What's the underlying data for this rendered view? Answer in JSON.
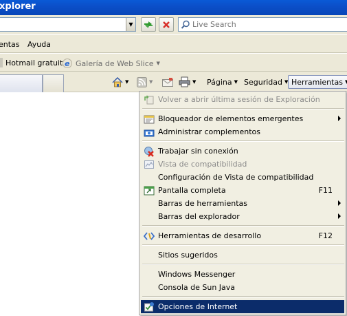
{
  "window": {
    "title": "xplorer"
  },
  "address": {
    "dropdown_glyph": "▼"
  },
  "search": {
    "placeholder": "Live Search"
  },
  "menubar": {
    "items": [
      "entas",
      "Ayuda"
    ]
  },
  "favorites": {
    "items": [
      {
        "label": "Hotmail gratuito",
        "icon": "page-icon"
      },
      {
        "label": "Galería de Web Slice",
        "icon": "ie-icon"
      }
    ]
  },
  "commandbar": {
    "page_label": "Página",
    "security_label": "Seguridad",
    "tools_label": "Herramientas"
  },
  "tools_menu": {
    "items": [
      {
        "label": "Volver a abrir última sesión de Exploración",
        "disabled": true,
        "icon": "reopen-session-icon"
      },
      {
        "label": "Bloqueador de elementos emergentes",
        "submenu": true,
        "icon": "popup-blocker-icon"
      },
      {
        "label": "Administrar complementos",
        "icon": "addons-icon"
      },
      {
        "label": "Trabajar sin conexión",
        "icon": "offline-icon"
      },
      {
        "label": "Vista de compatibilidad",
        "disabled": true,
        "icon": "compat-view-icon"
      },
      {
        "label": "Configuración de Vista de compatibilidad"
      },
      {
        "label": "Pantalla completa",
        "shortcut": "F11",
        "icon": "fullscreen-icon"
      },
      {
        "label": "Barras de herramientas",
        "submenu": true
      },
      {
        "label": "Barras del explorador",
        "submenu": true
      },
      {
        "label": "Herramientas de desarrollo",
        "shortcut": "F12",
        "icon": "dev-tools-icon"
      },
      {
        "label": "Sitios sugeridos"
      },
      {
        "label": "Windows Messenger"
      },
      {
        "label": "Consola de Sun Java"
      },
      {
        "label": "Opciones de Internet",
        "selected": true,
        "icon": "internet-options-icon"
      }
    ]
  },
  "colors": {
    "titlebar": "#0b4fc9",
    "chrome": "#ece9d8",
    "menu_bg": "#f1efe2",
    "highlight": "#0b2c6a"
  }
}
